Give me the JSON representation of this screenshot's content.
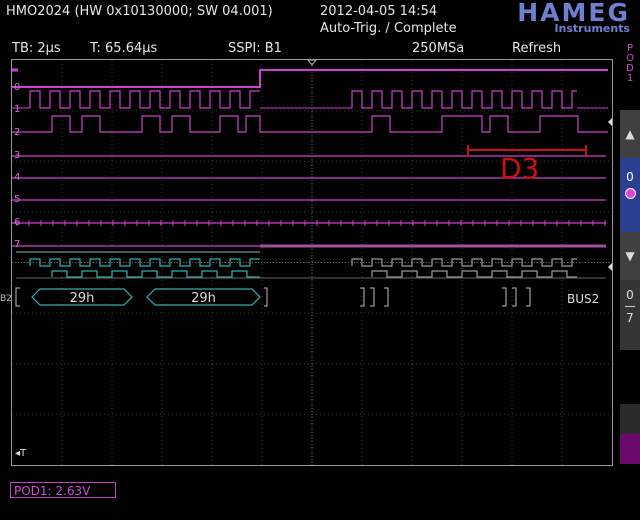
{
  "header": {
    "device_info": "HMO2024 (HW 0x10130000; SW 04.001)",
    "datetime": "2012-04-05 14:54",
    "trigger_status": "Auto-Trig. / Complete",
    "brand": "HAMEG",
    "brand_sub": "Instruments"
  },
  "status": {
    "timebase": "TB: 2µs",
    "trigger_time": "T: 65.64µs",
    "trigger_source": "SSPI: B1",
    "sample_rate": "250MSa",
    "mode": "Refresh"
  },
  "channels": [
    "0",
    "1",
    "2",
    "3",
    "4",
    "5",
    "6",
    "7"
  ],
  "bus": {
    "left_label": "B2",
    "name": "BUS2",
    "decoded": [
      "29h",
      "29h"
    ]
  },
  "cursor_label": "D3",
  "time_marker": "T",
  "right_panel": {
    "pod_tab": "POD1",
    "up": "▲",
    "channel_value": "0",
    "down": "▼",
    "range_top": "0",
    "range_bottom": "7"
  },
  "pod_readout": "POD1: 2.63V",
  "colors": {
    "logic": "#d040d0",
    "bus": "#30b0b0",
    "cursor": "#cc1111",
    "brand": "#6f80d0",
    "grid": "#3a3a3a"
  }
}
